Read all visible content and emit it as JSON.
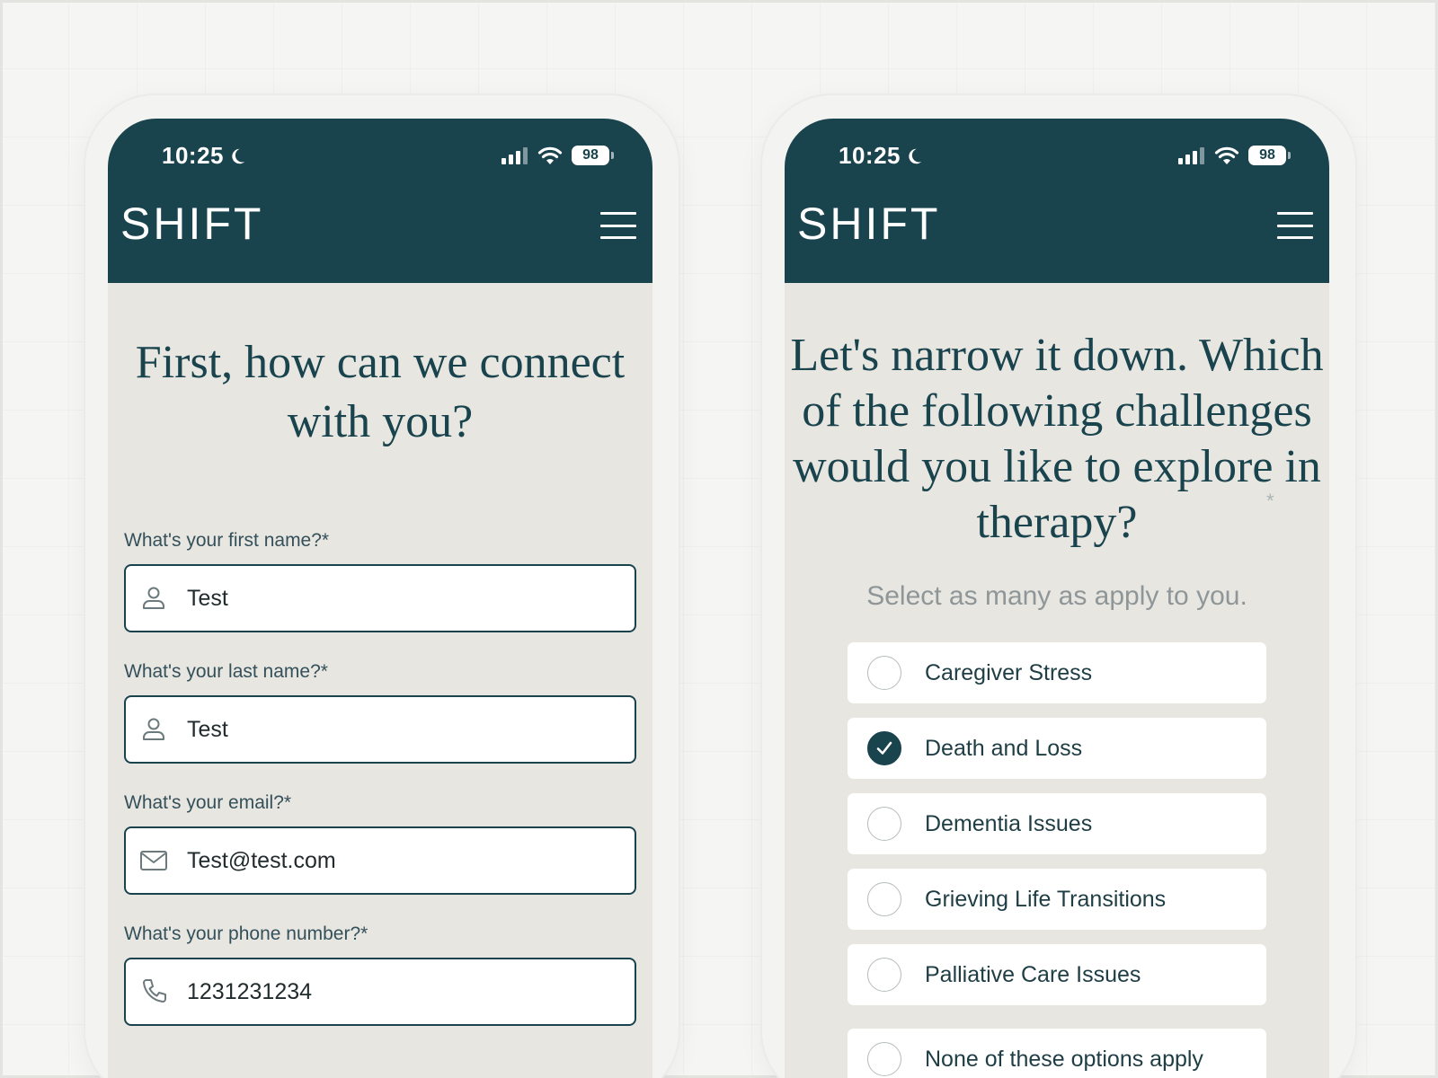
{
  "colors": {
    "primary": "#19434d",
    "screen_bg": "#e8e6e1",
    "field_bg": "#ffffff",
    "muted_text": "#8e9698"
  },
  "status_bar": {
    "time": "10:25",
    "battery": "98"
  },
  "brand": {
    "name": "SHIFT"
  },
  "contact_screen": {
    "title": "First, how can we connect with you?",
    "fields": [
      {
        "label": "What's your first name?*",
        "value": "Test",
        "icon": "user-icon"
      },
      {
        "label": "What's your last name?*",
        "value": "Test",
        "icon": "user-icon"
      },
      {
        "label": "What's your email?*",
        "value": "Test@test.com",
        "icon": "mail-icon"
      },
      {
        "label": "What's your phone number?*",
        "value": "1231231234",
        "icon": "phone-icon"
      }
    ]
  },
  "challenges_screen": {
    "title": "Let's narrow it down. Which of the following challenges would you like to explore in therapy?",
    "required_mark": "*",
    "subtitle": "Select as many as apply to you.",
    "options": [
      {
        "label": "Caregiver Stress",
        "checked": false
      },
      {
        "label": "Death and Loss",
        "checked": true
      },
      {
        "label": "Dementia Issues",
        "checked": false
      },
      {
        "label": "Grieving Life Transitions",
        "checked": false
      },
      {
        "label": "Palliative Care Issues",
        "checked": false
      },
      {
        "label": "None of these options apply",
        "checked": false
      }
    ]
  }
}
